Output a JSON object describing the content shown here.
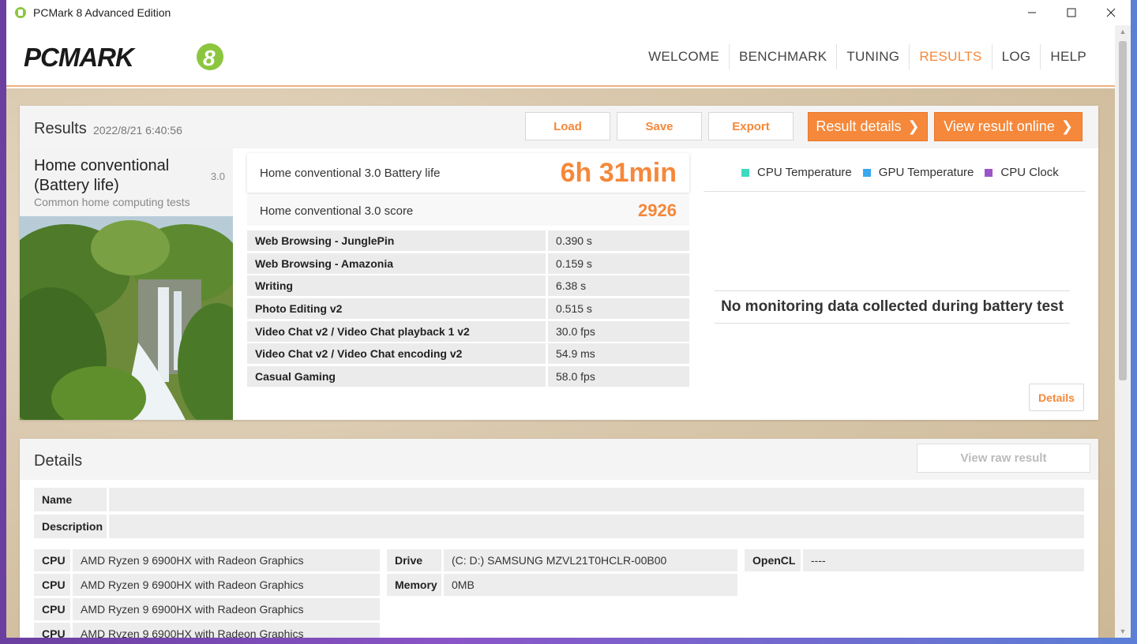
{
  "window": {
    "title": "PCMark 8 Advanced Edition"
  },
  "nav": {
    "items": [
      "WELCOME",
      "BENCHMARK",
      "TUNING",
      "RESULTS",
      "LOG",
      "HELP"
    ],
    "active": "RESULTS"
  },
  "logo": {
    "text": "PCMARK",
    "number": "8"
  },
  "results": {
    "title": "Results",
    "date": "2022/8/21 6:40:56",
    "buttons": {
      "load": "Load",
      "save": "Save",
      "export": "Export",
      "result_details": "Result details",
      "view_online": "View result online"
    }
  },
  "test": {
    "name": "Home conventional (Battery life)",
    "version": "3.0",
    "description": "Common home computing tests"
  },
  "scores": {
    "battery_label": "Home conventional 3.0 Battery life",
    "battery_value": "6h 31min",
    "score_label": "Home conventional 3.0 score",
    "score_value": "2926",
    "subtests": [
      {
        "name": "Web Browsing - JunglePin",
        "value": "0.390 s"
      },
      {
        "name": "Web Browsing - Amazonia",
        "value": "0.159 s"
      },
      {
        "name": "Writing",
        "value": "6.38 s"
      },
      {
        "name": "Photo Editing v2",
        "value": "0.515 s"
      },
      {
        "name": "Video Chat v2 / Video Chat playback 1 v2",
        "value": "30.0 fps"
      },
      {
        "name": "Video Chat v2 / Video Chat encoding v2",
        "value": "54.9 ms"
      },
      {
        "name": "Casual Gaming",
        "value": "58.0 fps"
      }
    ]
  },
  "monitoring": {
    "legend": [
      {
        "label": "CPU Temperature",
        "color": "#3ddbc0"
      },
      {
        "label": "GPU Temperature",
        "color": "#3aa8ee"
      },
      {
        "label": "CPU Clock",
        "color": "#9a55c8"
      }
    ],
    "message": "No monitoring data collected during battery test",
    "details_button": "Details"
  },
  "details": {
    "title": "Details",
    "raw_button": "View raw result",
    "name_label": "Name",
    "description_label": "Description",
    "cpu_label": "CPU",
    "cpus": [
      "AMD Ryzen 9 6900HX with Radeon Graphics",
      "AMD Ryzen 9 6900HX with Radeon Graphics",
      "AMD Ryzen 9 6900HX with Radeon Graphics",
      "AMD Ryzen 9 6900HX with Radeon Graphics"
    ],
    "drive_label": "Drive",
    "drive_value": "(C: D:) SAMSUNG MZVL21T0HCLR-00B00",
    "memory_label": "Memory",
    "memory_value": "0MB",
    "opencl_label": "OpenCL",
    "opencl_value": "----"
  },
  "colors": {
    "accent": "#f5883a"
  }
}
